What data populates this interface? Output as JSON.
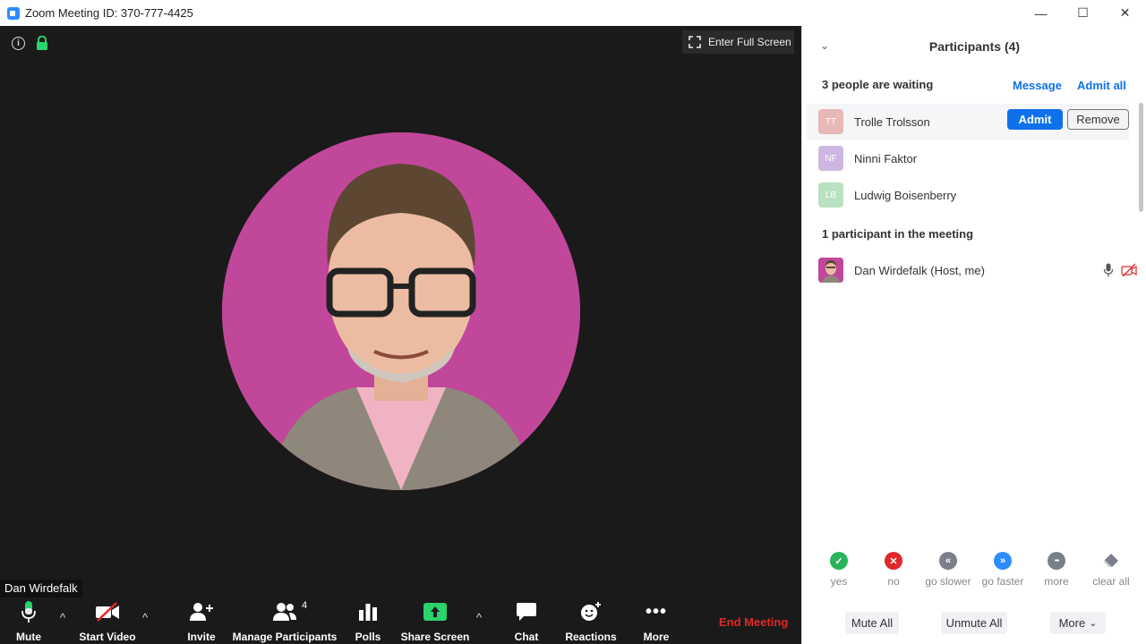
{
  "window": {
    "title": "Zoom Meeting ID: 370-777-4425",
    "controls": {
      "minimize": "—",
      "maximize": "☐",
      "close": "✕"
    }
  },
  "video": {
    "fullscreen_label": "Enter Full Screen",
    "speaker_name": "Dan Wirdefalk"
  },
  "toolbar": {
    "mute": "Mute",
    "start_video": "Start Video",
    "invite": "Invite",
    "manage_participants": "Manage Participants",
    "participants_count": "4",
    "polls": "Polls",
    "share_screen": "Share Screen",
    "chat": "Chat",
    "reactions": "Reactions",
    "more": "More",
    "end_meeting": "End Meeting",
    "accent_color": "#2ad36b",
    "end_color": "#e02828"
  },
  "panel": {
    "title": "Participants (4)",
    "waiting_header": "3 people are waiting",
    "message_link": "Message",
    "admit_all_link": "Admit all",
    "waiting": [
      {
        "initials": "TT",
        "name": "Trolle Trolsson",
        "color": "#e8b7b7"
      },
      {
        "initials": "NF",
        "name": "Ninni Faktor",
        "color": "#cdb7e2"
      },
      {
        "initials": "LB",
        "name": "Ludwig Boisenberry",
        "color": "#b9e2c2"
      }
    ],
    "admit_label": "Admit",
    "remove_label": "Remove",
    "meeting_header": "1 participant in the meeting",
    "host": {
      "name": "Dan Wirdefalk (Host, me)"
    },
    "reactions": [
      {
        "label": "yes",
        "color": "#29b35a",
        "glyph": "✓"
      },
      {
        "label": "no",
        "color": "#e02828",
        "glyph": "✕"
      },
      {
        "label": "go slower",
        "color": "#7a7f8a",
        "glyph": "«"
      },
      {
        "label": "go faster",
        "color": "#2d8cff",
        "glyph": "»"
      },
      {
        "label": "more",
        "color": "#7a7f8a",
        "glyph": "•••"
      },
      {
        "label": "clear all",
        "color": "#7a7f8a",
        "glyph": ""
      }
    ],
    "mute_all": "Mute All",
    "unmute_all": "Unmute All",
    "more": "More"
  }
}
